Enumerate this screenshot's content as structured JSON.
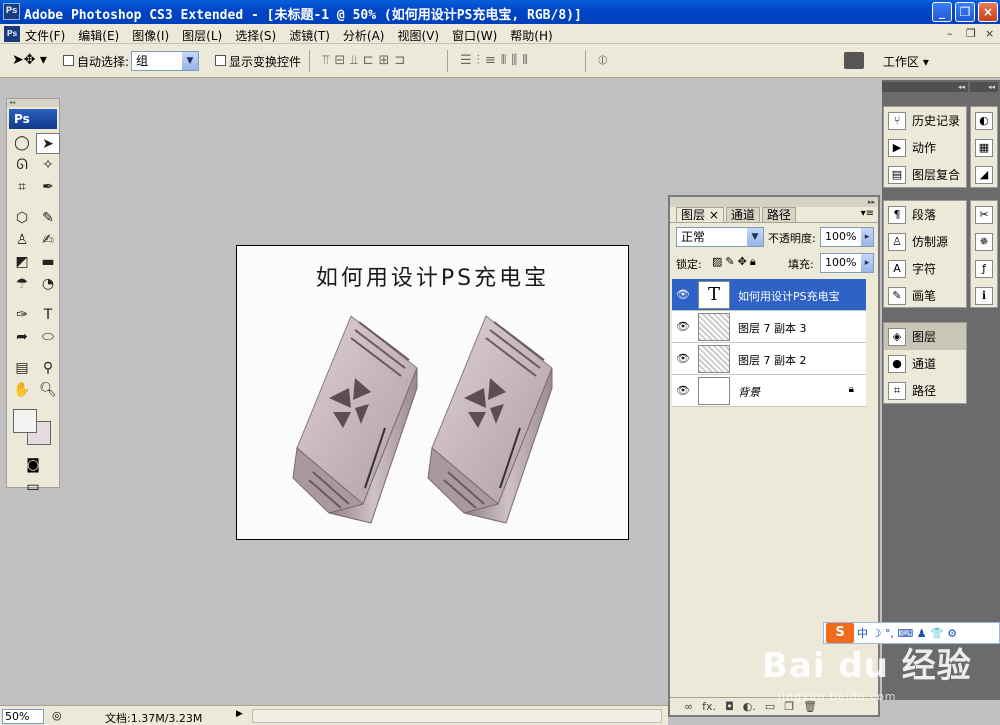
{
  "window": {
    "title": "Adobe Photoshop CS3 Extended - [未标题-1 @ 50% (如何用设计PS充电宝, RGB/8)]",
    "app_logo": "Ps"
  },
  "menu": {
    "items": [
      "文件(F)",
      "编辑(E)",
      "图像(I)",
      "图层(L)",
      "选择(S)",
      "滤镜(T)",
      "分析(A)",
      "视图(V)",
      "窗口(W)",
      "帮助(H)"
    ]
  },
  "options": {
    "auto_select_label": "自动选择:",
    "auto_select_value": "组",
    "show_transform_label": "显示变换控件",
    "workspace_label": "工作区"
  },
  "toolbox": {
    "header": "Ps"
  },
  "document": {
    "title": "如何用设计PS充电宝",
    "background": "#fcfbfb"
  },
  "layers_panel": {
    "tabs": [
      "图层",
      "通道",
      "路径"
    ],
    "blend_mode": "正常",
    "opacity_label": "不透明度:",
    "opacity_value": "100%",
    "lock_label": "锁定:",
    "fill_label": "填充:",
    "fill_value": "100%",
    "layers": [
      {
        "name": "如何用设计PS充电宝",
        "type": "text",
        "selected": true
      },
      {
        "name": "图层 7 副本 3",
        "type": "pixel",
        "selected": false
      },
      {
        "name": "图层 7 副本 2",
        "type": "pixel",
        "selected": false
      },
      {
        "name": "背景",
        "type": "background",
        "selected": false,
        "locked": true
      }
    ],
    "text_thumb": "T"
  },
  "dock": {
    "group1": [
      "历史记录",
      "动作",
      "图层复合"
    ],
    "group2": [
      "段落",
      "仿制源",
      "字符",
      "画笔"
    ],
    "group3": [
      "图层",
      "通道",
      "路径"
    ]
  },
  "status": {
    "zoom": "50%",
    "doc_info": "文档:1.37M/3.23M"
  },
  "watermark": {
    "brand": "Bai du 经验",
    "url": "jingyan.baidu.com",
    "ime_logo": "S"
  }
}
